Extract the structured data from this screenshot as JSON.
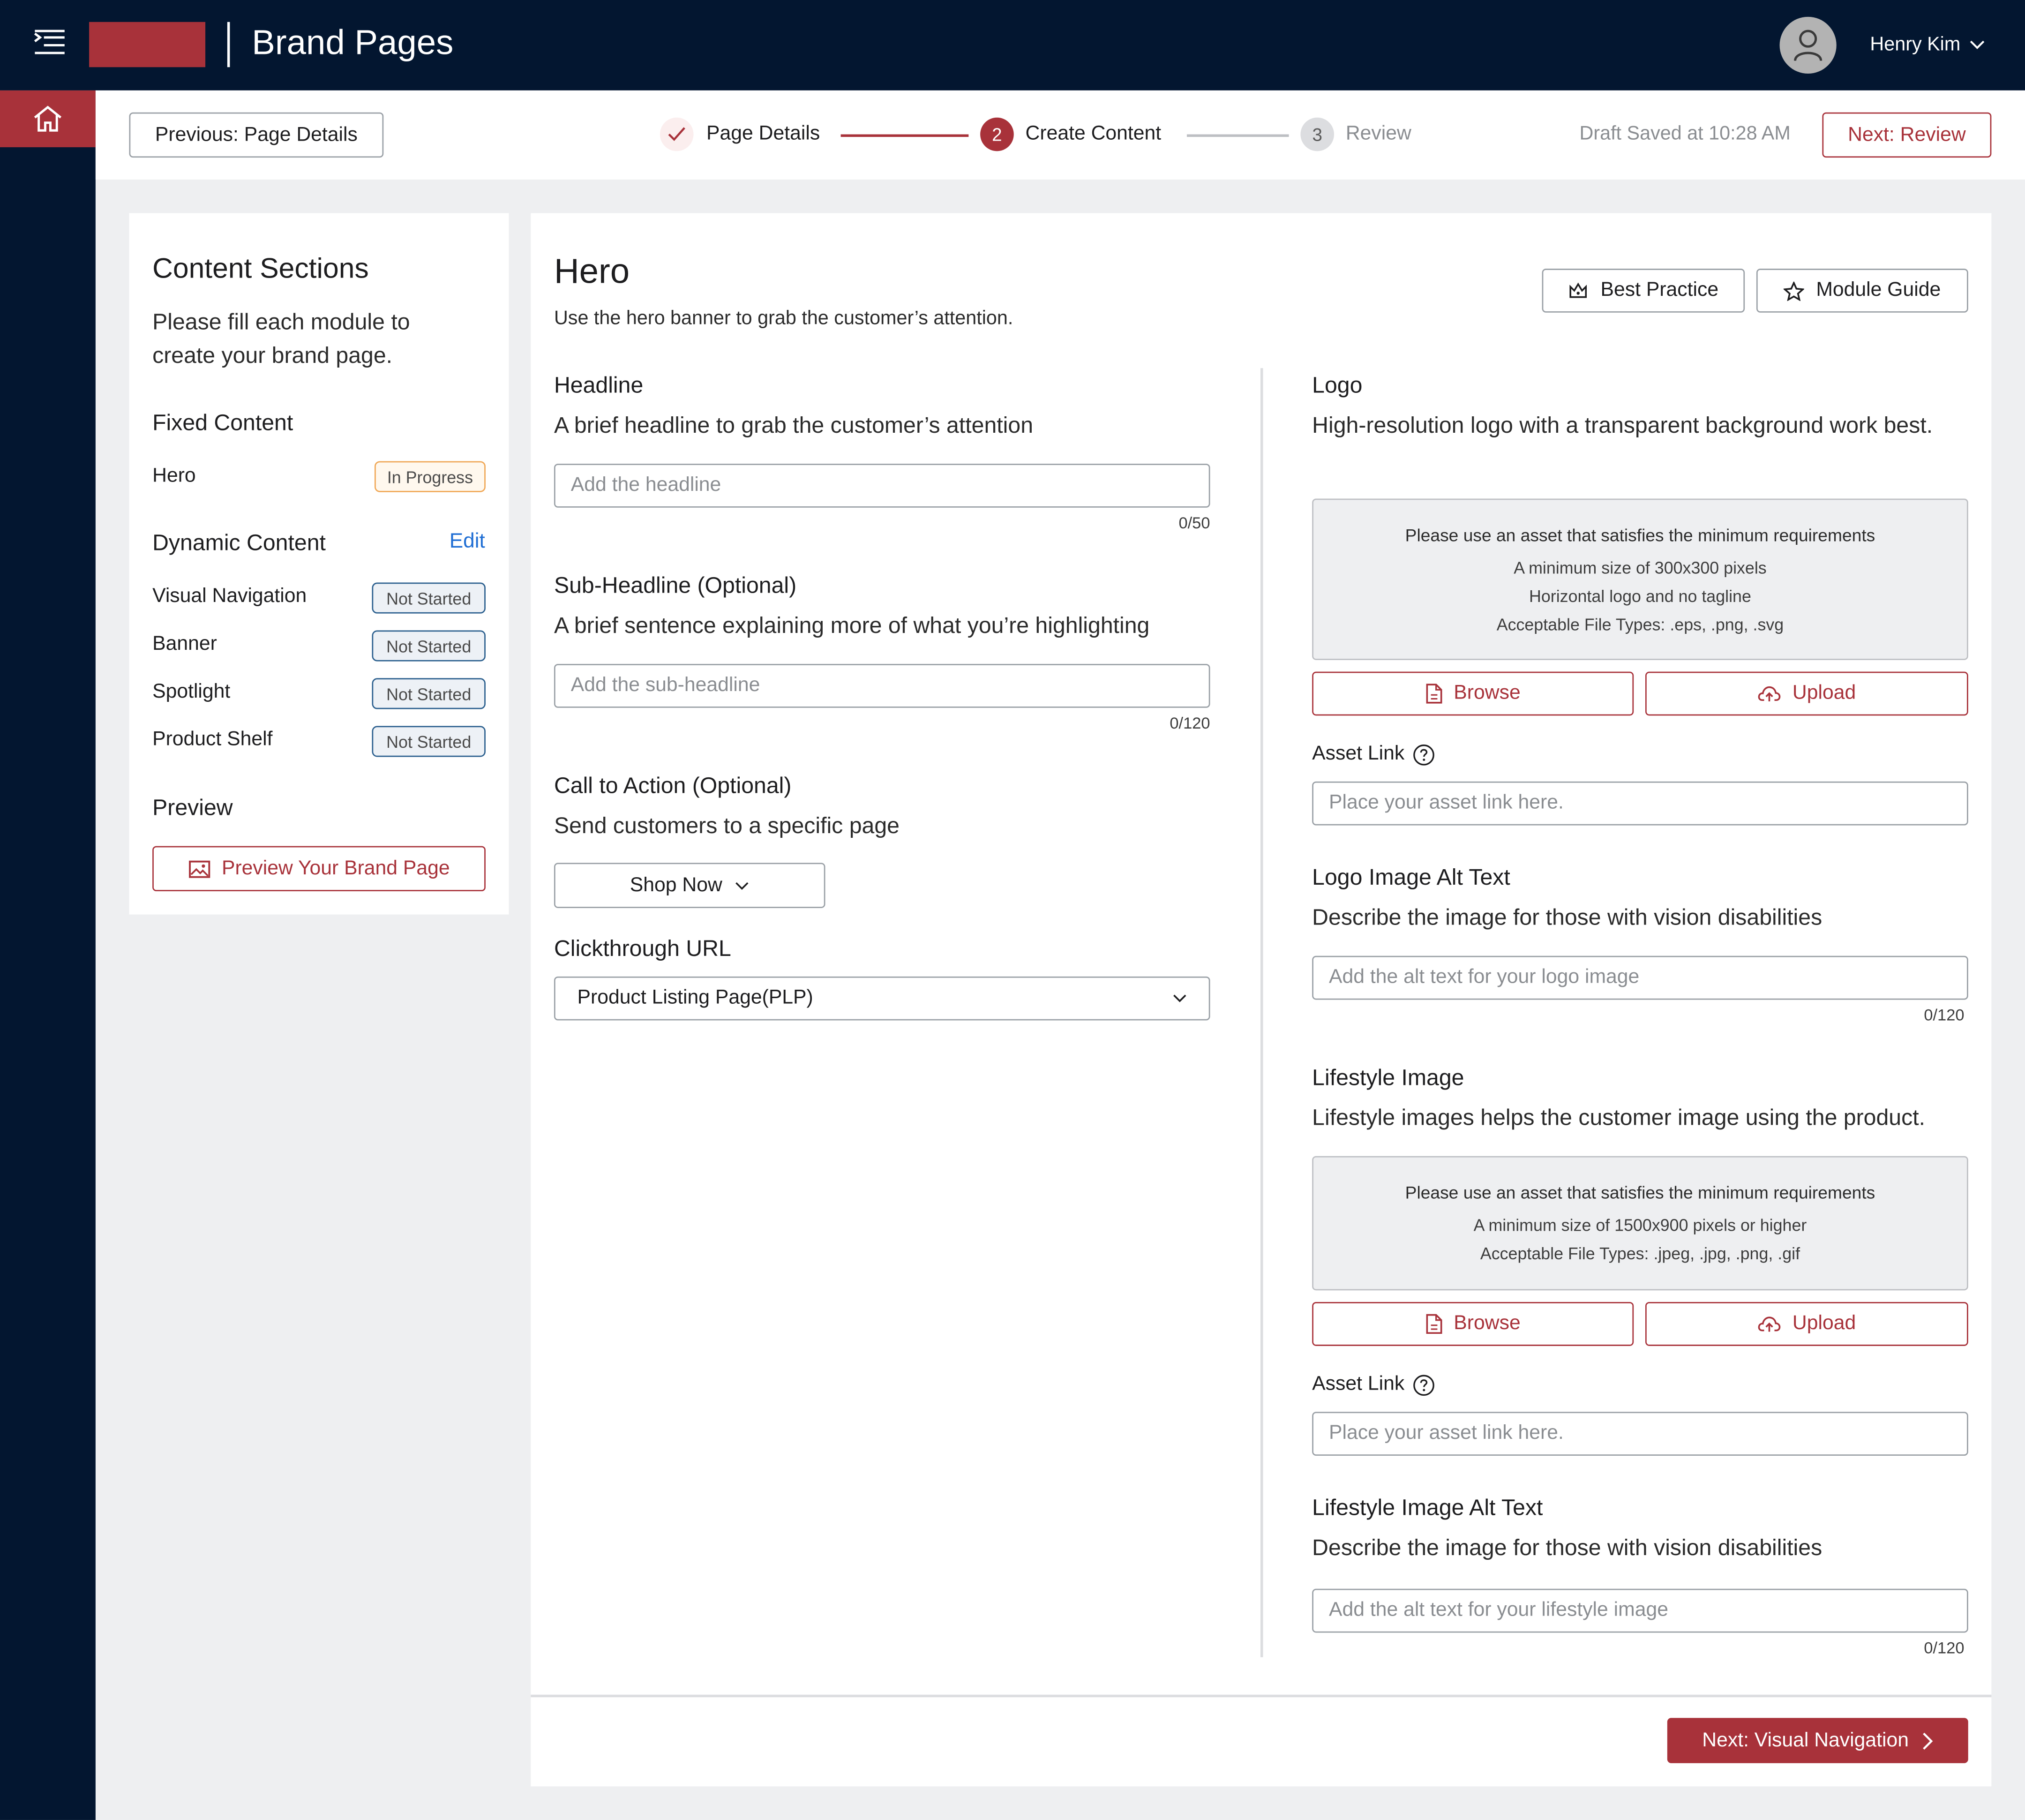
{
  "header": {
    "app_title": "Brand Pages",
    "user_name": "Henry Kim"
  },
  "stepper": {
    "prev_label": "Previous: Page Details",
    "steps": [
      {
        "number": "1",
        "label": "Page Details",
        "state": "done"
      },
      {
        "number": "2",
        "label": "Create Content",
        "state": "active"
      },
      {
        "number": "3",
        "label": "Review",
        "state": "upcoming"
      }
    ],
    "draft_status": "Draft Saved at 10:28 AM",
    "next_label": "Next: Review"
  },
  "sidebar": {
    "title": "Content Sections",
    "description": "Please fill each module to create your brand page.",
    "fixed_heading": "Fixed Content",
    "fixed_items": [
      {
        "label": "Hero",
        "status": "In Progress"
      }
    ],
    "dynamic_heading": "Dynamic Content",
    "edit_label": "Edit",
    "dynamic_items": [
      {
        "label": "Visual Navigation",
        "status": "Not Started"
      },
      {
        "label": "Banner",
        "status": "Not Started"
      },
      {
        "label": "Spotlight",
        "status": "Not Started"
      },
      {
        "label": "Product Shelf",
        "status": "Not Started"
      }
    ],
    "preview_heading": "Preview",
    "preview_button": "Preview Your Brand Page"
  },
  "hero": {
    "title": "Hero",
    "description": "Use the hero banner to grab the customer’s attention.",
    "best_practice": "Best Practice",
    "module_guide": "Module Guide",
    "headline": {
      "title": "Headline",
      "description": "A brief headline to grab the customer’s attention",
      "placeholder": "Add the headline",
      "counter": "0/50"
    },
    "subheadline": {
      "title": "Sub-Headline (Optional)",
      "description": "A brief sentence explaining more of what you’re highlighting",
      "placeholder": "Add  the sub-headline",
      "counter": "0/120"
    },
    "cta": {
      "title": "Call to Action (Optional)",
      "description": "Send customers to a specific page",
      "value": "Shop Now"
    },
    "clickthrough": {
      "title": "Clickthrough URL",
      "value": "Product Listing Page(PLP)"
    },
    "logo": {
      "title": "Logo",
      "description": "High-resolution logo with a transparent background work best.",
      "req_heading": "Please use an asset that satisfies the minimum requirements",
      "req_lines": [
        "A minimum size of 300x300 pixels",
        "Horizontal logo and no tagline",
        "Acceptable File Types: .eps, .png, .svg"
      ],
      "browse": "Browse",
      "upload": "Upload",
      "asset_link_label": "Asset Link",
      "asset_link_placeholder": "Place your asset link here."
    },
    "logo_alt": {
      "title": "Logo Image Alt Text",
      "description": "Describe the image for those with vision disabilities",
      "placeholder": "Add the alt text for your logo image",
      "counter": "0/120"
    },
    "lifestyle": {
      "title": "Lifestyle Image",
      "description": "Lifestyle images helps the customer image using the product.",
      "req_heading": "Please use an asset that satisfies the minimum requirements",
      "req_lines": [
        "A minimum size of 1500x900 pixels or higher",
        "Acceptable File Types: .jpeg, .jpg, .png, .gif"
      ],
      "browse": "Browse",
      "upload": "Upload",
      "asset_link_label": "Asset Link",
      "asset_link_placeholder": "Place your asset link here."
    },
    "lifestyle_alt": {
      "title": "Lifestyle Image Alt Text",
      "description": "Describe the image for those with vision disabilities",
      "placeholder": "Add the alt text for your lifestyle image",
      "counter": "0/120"
    },
    "next_button": "Next: Visual Navigation"
  },
  "colors": {
    "navy": "#031630",
    "accent_red": "#a8323a",
    "link_blue": "#1f6ed4",
    "in_progress_border": "#f0a857",
    "not_started_border": "#2b5f8e"
  },
  "icons": [
    "menu-icon",
    "home-icon",
    "user-icon",
    "chevron-down-icon",
    "check-icon",
    "crown-icon",
    "star-icon",
    "file-icon",
    "cloud-upload-icon",
    "help-circle-icon",
    "image-icon",
    "chevron-right-icon"
  ]
}
